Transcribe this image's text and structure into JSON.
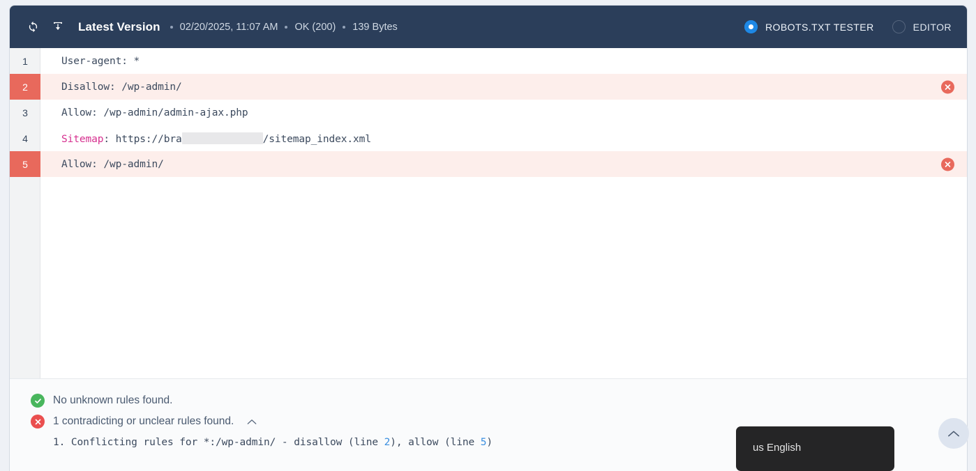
{
  "header": {
    "refresh_icon": "refresh-icon",
    "download_icon": "download-icon",
    "title": "Latest Version",
    "timestamp": "02/20/2025, 11:07 AM",
    "status": "OK (200)",
    "size": "139 Bytes",
    "modes": [
      {
        "label": "ROBOTS.TXT TESTER",
        "selected": true
      },
      {
        "label": "EDITOR",
        "selected": false
      }
    ],
    "bg_color": "#2b3e5a",
    "accent_color": "#1e88e5"
  },
  "editor": {
    "lines": [
      {
        "number": "1",
        "text": "User-agent: *",
        "error": false
      },
      {
        "number": "2",
        "text": "Disallow: /wp-admin/",
        "error": true
      },
      {
        "number": "3",
        "text": "Allow: /wp-admin/admin-ajax.php",
        "error": false
      },
      {
        "number": "4",
        "text": "Sitemap: https://bra",
        "keyword": "Sitemap",
        "redacted": true,
        "text_after": "/sitemap_index.xml",
        "error": false
      },
      {
        "number": "5",
        "text": "Allow: /wp-admin/",
        "error": true
      }
    ],
    "line4_prefix": "Sitemap",
    "line4_mid": ": https://bra",
    "line4_suffix": "/sitemap_index.xml",
    "error_color": "#e8695c",
    "error_row_bg": "#fdeeeb",
    "keyword_color": "#d6308f"
  },
  "results": {
    "unknown_rules": {
      "icon": "check-circle-icon",
      "text": "No unknown rules found.",
      "color": "#49b65d"
    },
    "conflicts": {
      "icon": "x-circle-icon",
      "text": "1 contradicting or unclear rules found.",
      "color": "#ea4f4f",
      "collapse_icon": "chevron-up-icon"
    },
    "detail_parts": {
      "a": "1. Conflicting rules for *:/wp-admin/ - disallow (line ",
      "line_a": "2",
      "b": "), allow (line ",
      "line_b": "5",
      "c": ")"
    }
  },
  "tooltip": {
    "text": "us English"
  },
  "scroll_top": {
    "icon": "chevron-up-icon"
  }
}
